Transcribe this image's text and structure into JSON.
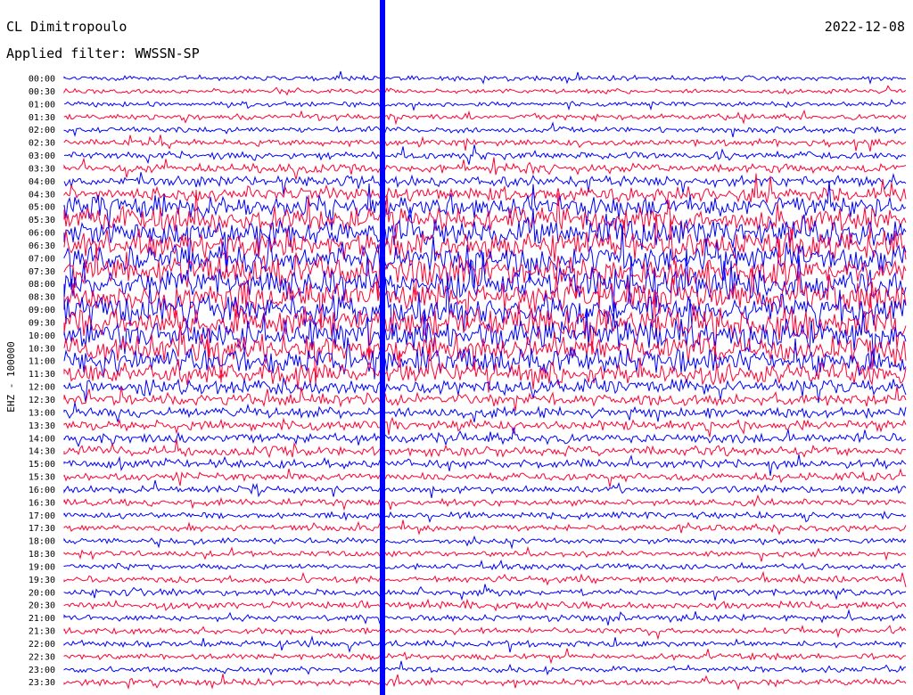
{
  "header": {
    "station": "CL Dimitropoulo",
    "date": "2022-12-08",
    "filter": "Applied filter: WWSSN-SP"
  },
  "chart_data": {
    "type": "line",
    "title": "",
    "ylabel": "EHZ - 100000",
    "xlabel": "",
    "colors": [
      "#0000ff",
      "#ff0033"
    ],
    "grid": false,
    "legend": "none",
    "y_ticks": [
      "00:00",
      "00:30",
      "01:00",
      "01:30",
      "02:00",
      "02:30",
      "03:00",
      "03:30",
      "04:00",
      "04:30",
      "05:00",
      "05:30",
      "06:00",
      "06:30",
      "07:00",
      "07:30",
      "08:00",
      "08:30",
      "09:00",
      "09:30",
      "10:00",
      "10:30",
      "11:00",
      "11:30",
      "12:00",
      "12:30",
      "13:00",
      "13:30",
      "14:00",
      "14:30",
      "15:00",
      "15:30",
      "16:00",
      "16:30",
      "17:00",
      "17:30",
      "18:00",
      "18:30",
      "19:00",
      "19:30",
      "20:00",
      "20:30",
      "21:00",
      "21:30",
      "22:00",
      "22:30",
      "23:00",
      "23:30"
    ],
    "trace_activity": [
      1,
      1,
      1,
      1.2,
      1.2,
      1.3,
      1.6,
      1.8,
      2.2,
      3,
      4.5,
      5,
      5.5,
      6,
      6,
      6,
      6,
      6,
      6,
      6,
      6,
      5.5,
      5,
      4.5,
      3.2,
      2.4,
      2.2,
      2,
      2,
      2,
      1.8,
      1.6,
      1.5,
      1.4,
      1.3,
      1.3,
      1.2,
      1.2,
      1.2,
      1.3,
      1.4,
      1.4,
      1.3,
      1.2,
      1.2,
      1.2,
      1.2,
      1.3
    ]
  }
}
